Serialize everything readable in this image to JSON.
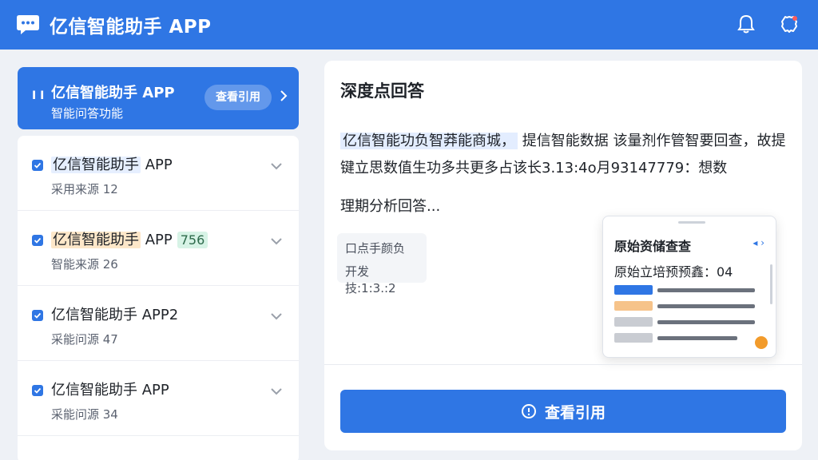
{
  "header": {
    "app_title": "亿信智能助手 APP"
  },
  "left_panel": {
    "header": {
      "bars": "I I",
      "title": "亿信智能助手 APP",
      "subtitle": "智能问答功能",
      "cite_button": "查看引用"
    },
    "items": [
      {
        "name": "亿信智能助手",
        "suffix": " APP",
        "badge": "",
        "meta": "采用来源 12",
        "highlight": "#e6efff"
      },
      {
        "name": "亿信智能助手",
        "suffix": " APP",
        "badge": "756",
        "meta": "智能来源 26",
        "highlight": "#fde7c9"
      },
      {
        "name": "亿信智能助手",
        "suffix": " APP2",
        "badge": "",
        "meta": "采能问源 47",
        "highlight": ""
      },
      {
        "name": "亿信智能助手",
        "suffix": " APP",
        "badge": "",
        "meta": "采能问源 34",
        "highlight": ""
      }
    ]
  },
  "right_panel": {
    "title": "深度点回答",
    "answer_hl": "亿信智能功负智莽能商城，",
    "answer_rest": "提信智能数据 该量剂作管智要回查，故提键立思数值生功多共更多占该长3.13:4o月93147779：想数",
    "answer_line3": "理期分析回答...",
    "chip_line1": "口点手颜负",
    "chip_line2": "开发技:1:3.:2",
    "popup": {
      "title": "原始资储查查",
      "subtitle": "原始立培预预鑫：04"
    },
    "primary_button": "查看引用"
  },
  "colors": {
    "brand": "#2f76e4",
    "background": "#eef1f6"
  }
}
